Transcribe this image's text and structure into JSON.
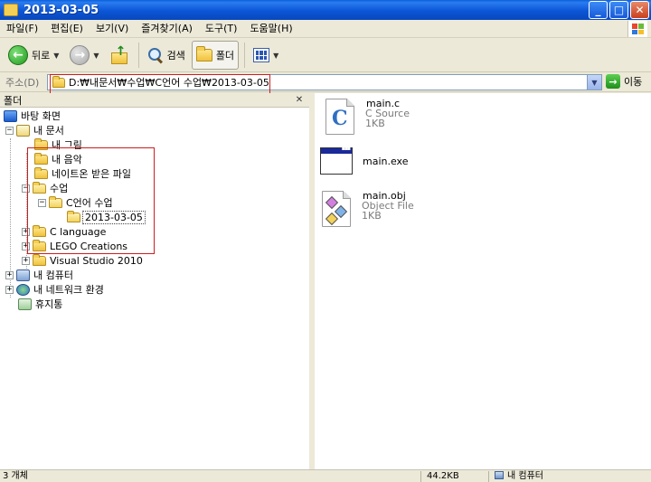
{
  "window": {
    "title": "2013-03-05"
  },
  "menu": [
    "파일(F)",
    "편집(E)",
    "보기(V)",
    "즐겨찾기(A)",
    "도구(T)",
    "도움말(H)"
  ],
  "toolbar": {
    "back_label": "뒤로",
    "search_label": "검색",
    "folders_label": "폴더"
  },
  "address": {
    "label": "주소(D)",
    "path": "D:₩내문서₩수업₩C언어 수업₩2013-03-05",
    "go_label": "이동"
  },
  "folders_pane": {
    "title": "폴더",
    "items": [
      {
        "label": "바탕 화면"
      },
      {
        "label": "내 문서"
      },
      {
        "label": "내 그림"
      },
      {
        "label": "내 음악"
      },
      {
        "label": "네이트온 받은 파일"
      },
      {
        "label": "수업"
      },
      {
        "label": "C언어 수업"
      },
      {
        "label": "2013-03-05"
      },
      {
        "label": "C language"
      },
      {
        "label": "LEGO Creations"
      },
      {
        "label": "Visual Studio 2010"
      },
      {
        "label": "내 컴퓨터"
      },
      {
        "label": "내 네트워크 환경"
      },
      {
        "label": "휴지통"
      }
    ]
  },
  "files": [
    {
      "name": "main.c",
      "type": "C Source",
      "size": "1KB"
    },
    {
      "name": "main.exe"
    },
    {
      "name": "main.obj",
      "type": "Object File",
      "size": "1KB"
    }
  ],
  "status": {
    "count": "3 개체",
    "size": "44.2KB",
    "location": "내 컴퓨터"
  },
  "colors": {
    "titlebar": "#0b56d6",
    "highlight": "#cc1e1e"
  }
}
